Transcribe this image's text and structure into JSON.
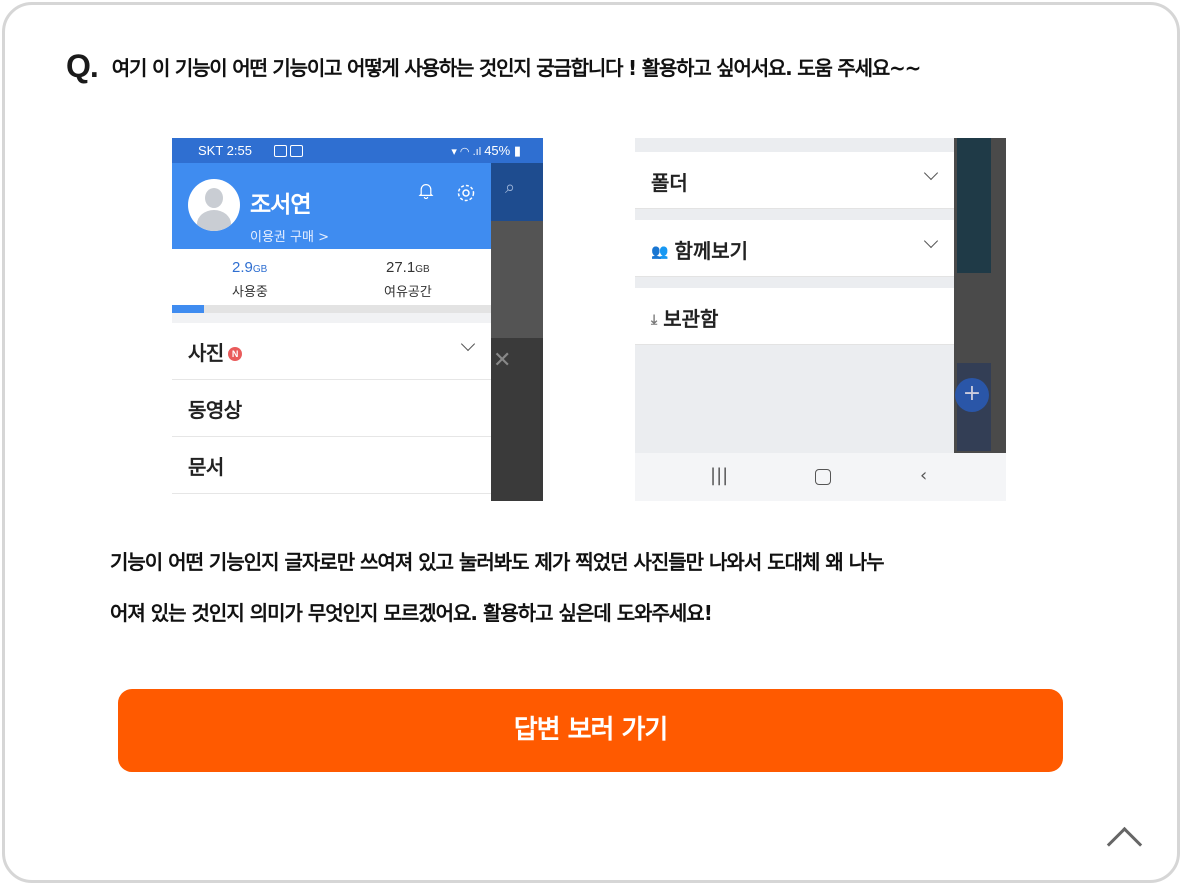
{
  "question": {
    "mark": "Q.",
    "text": "여기 이 기능이 어떤 기능이고 어떻게 사용하는 것인지 궁금합니다 ! 활용하고 싶어서요. 도움 주세요~~"
  },
  "left_screenshot": {
    "status_left": "SKT 2:55",
    "status_right": "45%",
    "profile_name": "조서연",
    "profile_sub": "이용권 구매 >",
    "used_value": "2.9",
    "used_unit": "GB",
    "used_label": "사용중",
    "free_value": "27.1",
    "free_unit": "GB",
    "free_label": "여유공간",
    "usage_fraction": 0.1,
    "menu": [
      "사진",
      "동영상",
      "문서"
    ],
    "new_badge": "N"
  },
  "right_screenshot": {
    "menu": [
      "폴더",
      "함께보기",
      "보관함"
    ]
  },
  "description": {
    "line1": "기능이 어떤 기능인지 글자로만 쓰여져 있고 눌러봐도 제가 찍었던 사진들만 나와서 도대체 왜 나누",
    "line2": "어져 있는 것인지 의미가 무엇인지 모르겠어요. 활용하고 싶은데 도와주세요!"
  },
  "cta": {
    "label": "답변 보러 가기"
  },
  "colors": {
    "accent": "#ff5a00",
    "app_blue": "#3f8cf0"
  }
}
